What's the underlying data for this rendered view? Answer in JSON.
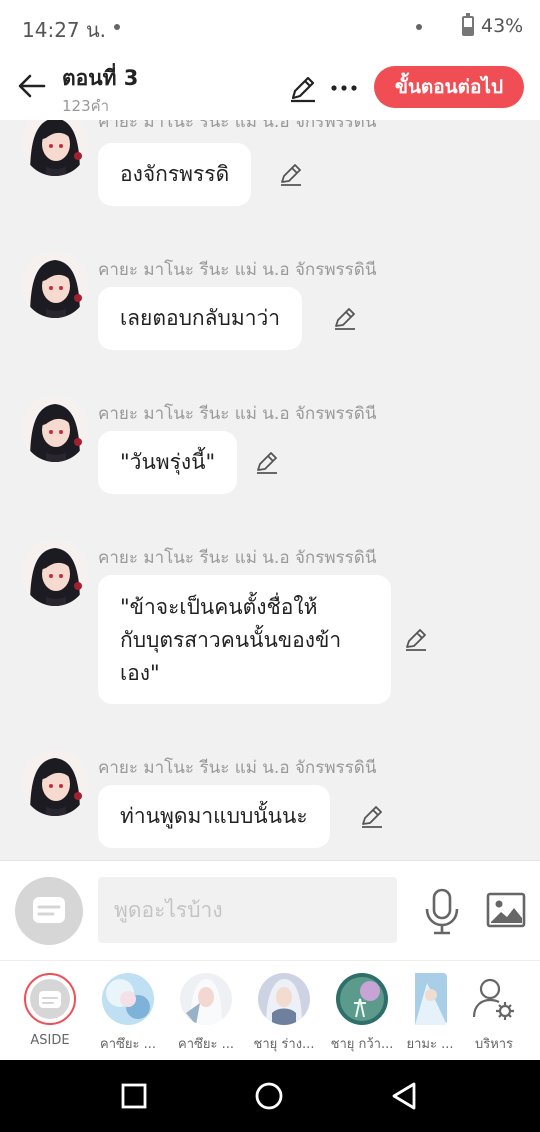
{
  "status": {
    "time": "14:27 น.",
    "battery": "43%"
  },
  "header": {
    "title": "ตอนที่ 3",
    "subtitle": "123คำ",
    "next_label": "ขั้นตอนต่อไป"
  },
  "messages": [
    {
      "speaker": "คายะ มาโนะ รีนะ แม่ น.อ จักรพรรดินี",
      "text": "องจักรพรรดิ"
    },
    {
      "speaker": "คายะ มาโนะ รีนะ แม่ น.อ จักรพรรดินี",
      "text": "เลยตอบกลับมาว่า"
    },
    {
      "speaker": "คายะ มาโนะ รีนะ แม่ น.อ จักรพรรดินี",
      "text": "\"วันพรุ่งนี้\""
    },
    {
      "speaker": "คายะ มาโนะ รีนะ แม่ น.อ จักรพรรดินี",
      "lines": [
        "\"ข้าจะเป็นคนตั้งชื่อให้",
        "กับบุตรสาวคนนั้นของข้า",
        "เอง\""
      ]
    },
    {
      "speaker": "คายะ มาโนะ รีนะ แม่ น.อ จักรพรรดินี",
      "text": "ท่านพูดมาแบบนั้นนะ"
    }
  ],
  "composer": {
    "placeholder": "พูดอะไรบ้าง"
  },
  "characters": [
    {
      "name": "ASIDE"
    },
    {
      "name": "คาซึยะ ..."
    },
    {
      "name": "คาซึยะ ..."
    },
    {
      "name": "ชายุ ร่าง..."
    },
    {
      "name": "ชายุ กว้า..."
    },
    {
      "name": "ยามะ ..."
    },
    {
      "name": "บริหาร"
    }
  ],
  "colors": {
    "accent": "#f04d55",
    "background": "#f1f1f1",
    "bubble": "#ffffff"
  },
  "icons": [
    "back-arrow-icon",
    "pencil-icon",
    "more-icon",
    "mic-icon",
    "image-icon",
    "settings-user-icon",
    "square-nav-icon",
    "circle-nav-icon",
    "triangle-nav-icon"
  ]
}
